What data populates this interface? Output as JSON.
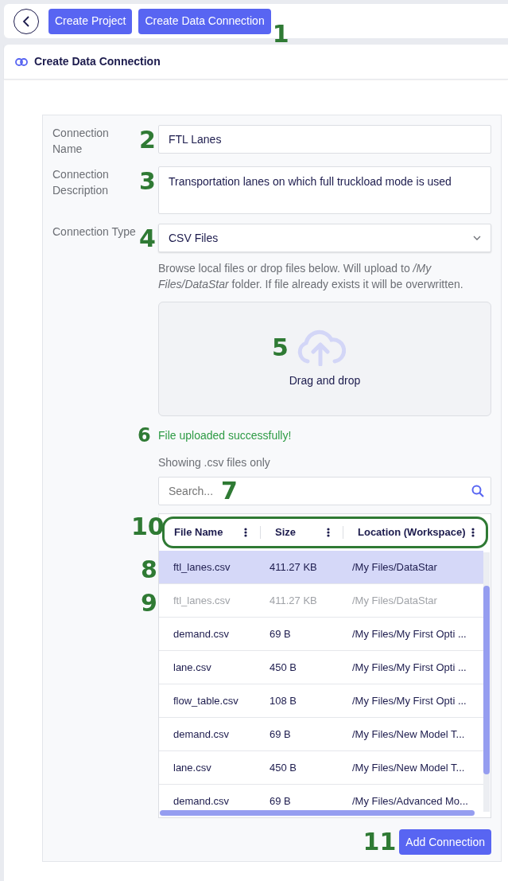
{
  "toolbar": {
    "buttons": [
      "Create Project",
      "Create Data Connection"
    ],
    "callout": "1"
  },
  "header": {
    "title": "Create Data Connection"
  },
  "fields": [
    {
      "kind": "input",
      "label": "Connection Name",
      "value": "FTL Lanes",
      "callout": "2"
    },
    {
      "kind": "textarea",
      "label": "Connection Description",
      "value": "Transportation lanes on which full truckload mode is used",
      "callout": "3"
    },
    {
      "kind": "select",
      "label": "Connection Type",
      "value": "CSV Files",
      "callout": "4"
    }
  ],
  "upload": {
    "hint": "Browse local files or drop files below. Will upload to */My Files/DataStar* folder. If file already exists it will be overwritten.",
    "dropzone_text": "Drag and drop",
    "dropzone_callout": "5",
    "status": "File uploaded successfully!",
    "status_callout": "6",
    "filter_note": "Showing .csv files only"
  },
  "search": {
    "placeholder": "Search...",
    "callout": "7"
  },
  "table": {
    "callout": "10",
    "header_outlined": true,
    "columns": [
      "File Name",
      "Size",
      "Location (Workspace)"
    ],
    "rows": [
      {
        "cells": [
          "ftl_lanes.csv",
          "411.27 KB",
          "/My Files/DataStar"
        ],
        "selected": true,
        "dimmed": false,
        "callout": "8"
      },
      {
        "cells": [
          "ftl_lanes.csv",
          "411.27 KB",
          "/My Files/DataStar"
        ],
        "selected": false,
        "dimmed": true,
        "callout": "9"
      },
      {
        "cells": [
          "demand.csv",
          "69 B",
          "/My Files/My First Opti ..."
        ],
        "selected": false,
        "dimmed": false
      },
      {
        "cells": [
          "lane.csv",
          "450 B",
          "/My Files/My First Opti ..."
        ],
        "selected": false,
        "dimmed": false
      },
      {
        "cells": [
          "flow_table.csv",
          "108 B",
          "/My Files/My First Opti ..."
        ],
        "selected": false,
        "dimmed": false
      },
      {
        "cells": [
          "demand.csv",
          "69 B",
          "/My Files/New Model T..."
        ],
        "selected": false,
        "dimmed": false
      },
      {
        "cells": [
          "lane.csv",
          "450 B",
          "/My Files/New Model T..."
        ],
        "selected": false,
        "dimmed": false
      },
      {
        "cells": [
          "demand.csv",
          "69 B",
          "/My Files/Advanced Mo..."
        ],
        "selected": false,
        "dimmed": false
      }
    ]
  },
  "submit": {
    "label": "Add Connection",
    "callout": "11"
  }
}
